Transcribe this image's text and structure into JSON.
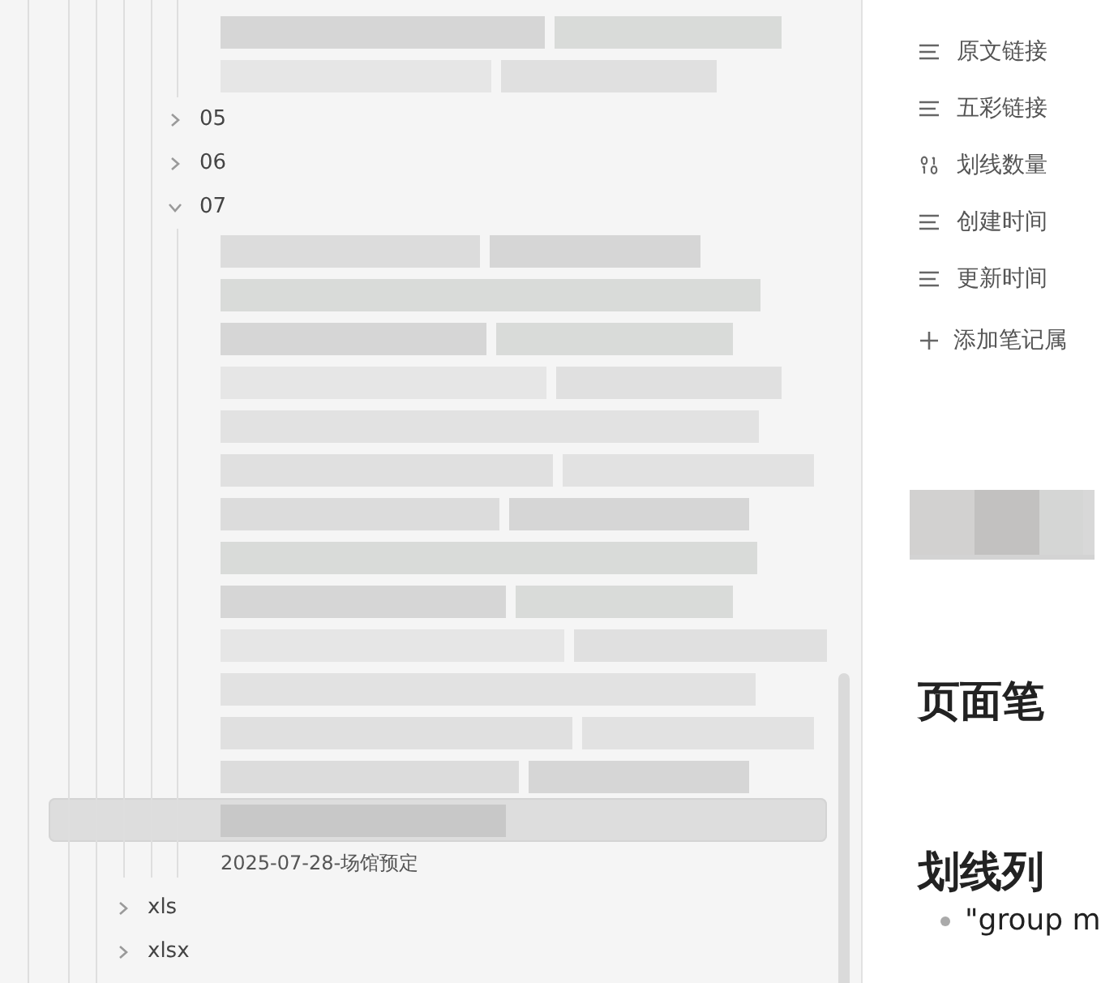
{
  "file_tree": {
    "continued_items": [
      {
        "kind": "redacted",
        "selected": false
      },
      {
        "kind": "redacted",
        "selected": false
      }
    ],
    "folders": [
      {
        "label": "05",
        "expanded": false
      },
      {
        "label": "06",
        "expanded": false
      },
      {
        "label": "07",
        "expanded": true,
        "children": [
          {
            "kind": "redacted",
            "selected": false
          },
          {
            "kind": "redacted",
            "selected": false
          },
          {
            "kind": "redacted",
            "selected": false
          },
          {
            "kind": "redacted",
            "selected": false
          },
          {
            "kind": "redacted",
            "selected": false
          },
          {
            "kind": "redacted",
            "selected": false
          },
          {
            "kind": "redacted",
            "selected": false
          },
          {
            "kind": "redacted",
            "selected": false
          },
          {
            "kind": "redacted",
            "selected": false
          },
          {
            "kind": "redacted",
            "selected": false
          },
          {
            "kind": "redacted",
            "selected": false
          },
          {
            "kind": "redacted",
            "selected": false
          },
          {
            "kind": "redacted",
            "selected": false
          },
          {
            "kind": "redacted",
            "selected": true
          },
          {
            "kind": "file",
            "label": "2025-07-28-场馆预定",
            "selected": false
          }
        ]
      }
    ],
    "after": [
      {
        "label": "xls",
        "expanded": false
      },
      {
        "label": "xlsx",
        "expanded": false
      }
    ]
  },
  "note": {
    "properties": [
      {
        "kind": "text",
        "label": "原文链接"
      },
      {
        "kind": "text",
        "label": "五彩链接"
      },
      {
        "kind": "number",
        "label": "划线数量"
      },
      {
        "kind": "text",
        "label": "创建时间"
      },
      {
        "kind": "text",
        "label": "更新时间"
      }
    ],
    "add_property": "添加笔记属",
    "headings": [
      {
        "text": "页面笔"
      },
      {
        "text": "划线列",
        "bullets": [
          "\"group m"
        ]
      }
    ]
  }
}
